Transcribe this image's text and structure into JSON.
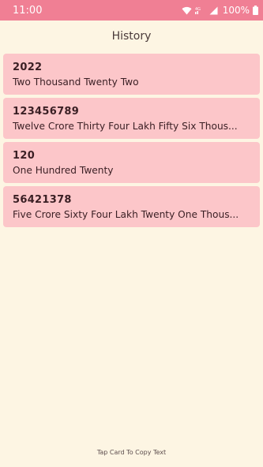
{
  "status_bar": {
    "time": "11:00",
    "battery": "100%",
    "network": "4G"
  },
  "header": {
    "title": "History"
  },
  "history": [
    {
      "number": "2022",
      "words": "Two Thousand Twenty Two"
    },
    {
      "number": "123456789",
      "words": "Twelve Crore Thirty Four Lakh Fifty Six Thous..."
    },
    {
      "number": "120",
      "words": "One Hundred Twenty"
    },
    {
      "number": "56421378",
      "words": "Five Crore Sixty Four Lakh Twenty One Thous..."
    }
  ],
  "footer": {
    "hint": "Tap Card To Copy Text"
  },
  "colors": {
    "status_bar": "#f07f94",
    "background": "#fdf5e3",
    "card": "#fcc6c9"
  }
}
